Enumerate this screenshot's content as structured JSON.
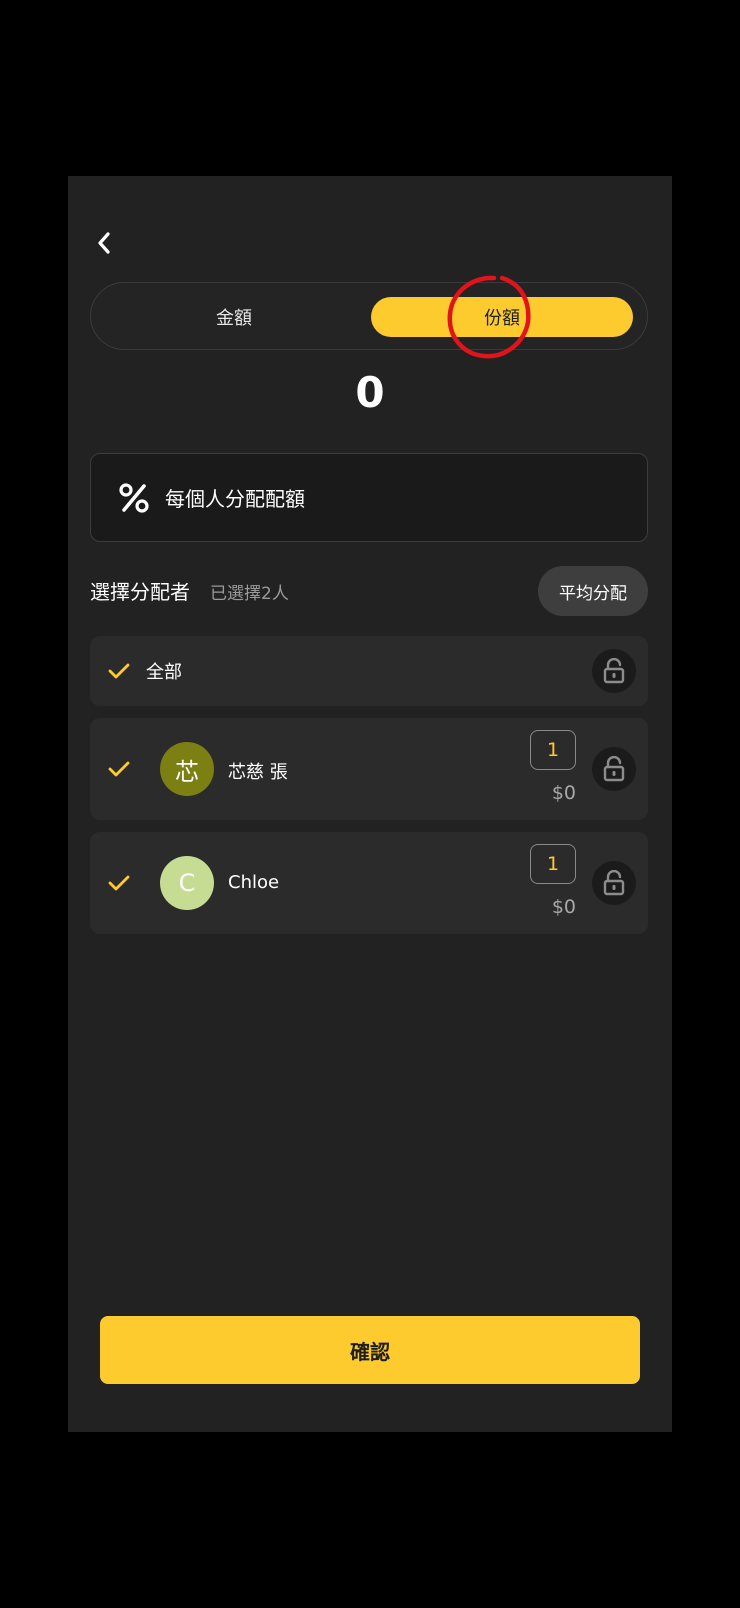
{
  "tabs": {
    "amount_label": "金額",
    "share_label": "份額",
    "active": "份額"
  },
  "total_value": "0",
  "hint": {
    "icon": "percent-icon",
    "text": "每個人分配配額"
  },
  "section": {
    "title": "選擇分配者",
    "selected_count": "已選擇2人",
    "average_button": "平均分配"
  },
  "all_row": {
    "label": "全部",
    "checked": true
  },
  "participants": [
    {
      "avatar_text": "芯",
      "avatar_color": "#7c7f12",
      "name": "芯慈 張",
      "share": "1",
      "amount": "$0",
      "checked": true
    },
    {
      "avatar_text": "C",
      "avatar_color": "#c5dc92",
      "name": "Chloe",
      "share": "1",
      "amount": "$0",
      "checked": true
    }
  ],
  "confirm_label": "確認",
  "colors": {
    "accent": "#fecb2f",
    "background": "#222222",
    "card": "#2b2b2b",
    "annotation": "#e0141a"
  }
}
